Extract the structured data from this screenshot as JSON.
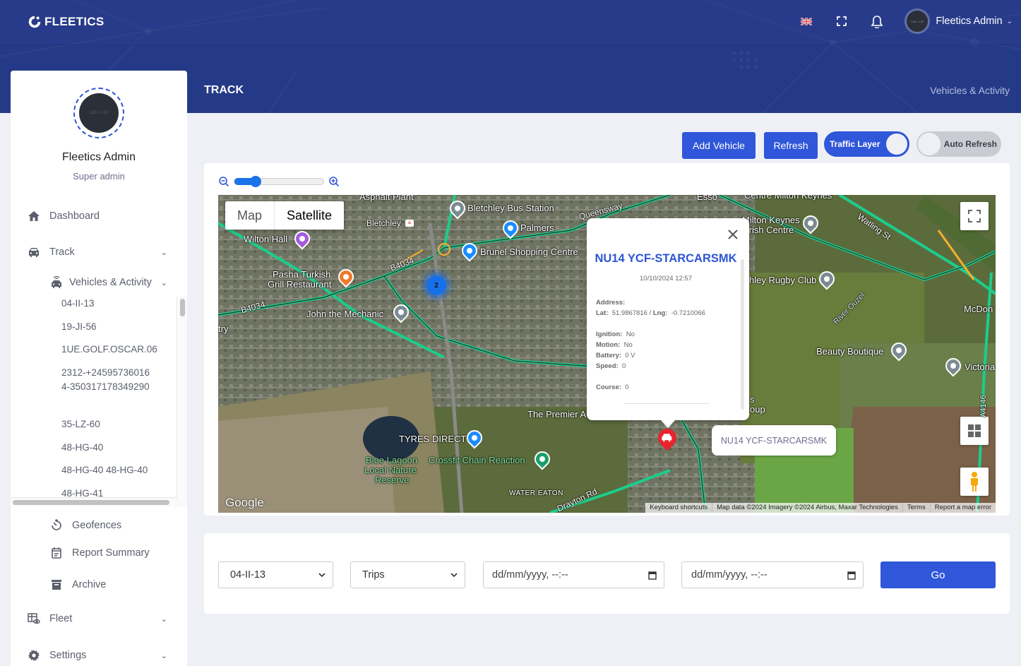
{
  "app": {
    "logo_text": "FLEETICS",
    "user_name": "Fleetics Admin",
    "avatar_placeholder": "128 x 128",
    "icons": [
      "uk-flag-icon",
      "fullscreen-icon",
      "bell-icon",
      "chevron-down-icon"
    ]
  },
  "page": {
    "title": "TRACK",
    "breadcrumb": "Vehicles & Activity"
  },
  "sidebar": {
    "profile": {
      "avatar_placeholder": "128 x 128",
      "name": "Fleetics Admin",
      "role": "Super admin"
    },
    "menu": [
      {
        "label": "Dashboard",
        "icon": "home-icon"
      },
      {
        "label": "Track",
        "icon": "car-icon",
        "expanded": true
      },
      {
        "label": "Vehicles & Activity",
        "icon": "connected-car-icon",
        "expanded": true
      },
      {
        "label": "Geofences",
        "icon": "timer-icon"
      },
      {
        "label": "Report Summary",
        "icon": "calendar-icon"
      },
      {
        "label": "Archive",
        "icon": "archive-icon"
      },
      {
        "label": "Fleet",
        "icon": "fleet-icon"
      },
      {
        "label": "Settings",
        "icon": "gear-icon"
      }
    ],
    "vehicles": [
      "04-II-13",
      "19-JI-56",
      "1UE.GOLF.OSCAR.06",
      "2312-+245957360164-350317178349290",
      "35-LZ-60",
      "48-HG-40",
      "48-HG-40 48-HG-40",
      "48-HG-41"
    ]
  },
  "toolbar": {
    "add_vehicle": "Add Vehicle",
    "refresh": "Refresh",
    "traffic_layer": {
      "label": "Traffic Layer",
      "on": true
    },
    "auto_refresh": {
      "label": "Auto Refresh",
      "on": false
    },
    "accent": "#3056d9"
  },
  "map": {
    "zoom_slider_value": 0.2,
    "map_type": {
      "options": [
        "Map",
        "Satellite"
      ],
      "selected": "Satellite"
    },
    "cluster_count": "2",
    "pois": [
      "Asphalt Plant",
      "Bletchley Bus Station",
      "Queensway",
      "Esso",
      "Centre Milton Keynes",
      "Bletchley",
      "Palmers",
      "Wilton Hall",
      "Brunel Shopping Centre",
      "Milton Keynes Irish Centre",
      "Pasha Turkish Grill Restaurant",
      "B4034",
      "John the Mechanic",
      "Watling St",
      "Bletchley Rugby Club",
      "River Ouzel",
      "McDon",
      "Beauty Boutique",
      "Victoria",
      "The Premier A",
      "TYRES DIRECT",
      "Blue Lagoon Local Nature Reserve",
      "Crossfit Chain Reaction",
      "WATER EATON",
      "Drayton Rd",
      "A4146"
    ],
    "poi_labels": {
      "asphalt": "Asphalt Plant",
      "bus": "Bletchley Bus Station",
      "queensway": "Queensway",
      "esso": "Esso",
      "centre": "Centre Milton Keynes",
      "bletchley": "Bletchley",
      "palmers": "Palmers",
      "wilton": "Wilton Hall",
      "brunel": "Brunel Shopping Centre",
      "irish1": "Milton Keynes",
      "irish2": "Irish Centre",
      "pasha1": "Pasha Turkish",
      "pasha2": "Grill Restaurant",
      "b4034a": "B4034",
      "b4034b": "B4034",
      "john": "John the Mechanic",
      "watling": "Watling St",
      "rugby": "hley Rugby Club",
      "ouzel": "River Ouzel",
      "mcdon": "McDon",
      "beauty": "Beauty Boutique",
      "victoria": "Victoria",
      "premier": "The Premier A",
      "tyres": "TYRES DIRECT",
      "lagoon1": "Blue Lagoon",
      "lagoon2": "Local Nature",
      "lagoon3": "Reserve",
      "crossfit": "Crossfit Chain Reaction",
      "water": "WATER EATON",
      "drayton": "Drayton Rd",
      "a4146": "A4146",
      "try": "try",
      "s_oup1": "s",
      "s_oup2": "oup"
    },
    "google_logo": "Google",
    "attribution": [
      "Keyboard shortcuts",
      "Map data ©2024 Imagery ©2024 Airbus, Maxar Technologies",
      "Terms",
      "Report a map error"
    ],
    "info_window": {
      "title": "NU14 YCF-STARCARSMK",
      "timestamp": "10/10/2024 12:57",
      "address_label": "Address:",
      "address_value": "",
      "lat_label": "Lat:",
      "lat": "51.9867816",
      "lng_label": "Lng:",
      "lng": "-0.7210066",
      "ignition_label": "Ignition:",
      "ignition": "No",
      "motion_label": "Motion:",
      "motion": "No",
      "battery_label": "Battery:",
      "battery": "0 V",
      "speed_label": "Speed:",
      "speed": "0",
      "course_label": "Course:",
      "course": "0"
    },
    "marker_label": "NU14 YCF-STARCARSMK"
  },
  "filters": {
    "vehicle_select": "04-II-13",
    "type_select": "Trips",
    "from_placeholder": "dd/mm/yyyy, --:--",
    "to_placeholder": "dd/mm/yyyy, --:--",
    "go": "Go"
  }
}
